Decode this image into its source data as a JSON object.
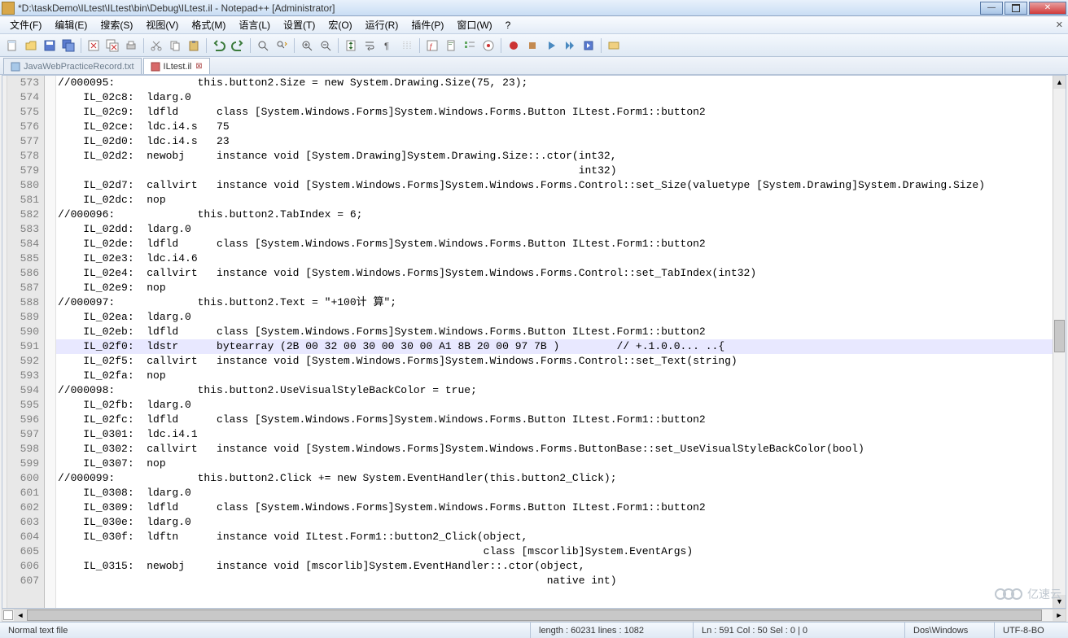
{
  "title": "*D:\\taskDemo\\ILtest\\ILtest\\bin\\Debug\\ILtest.il - Notepad++ [Administrator]",
  "menus": [
    "文件(F)",
    "编辑(E)",
    "搜索(S)",
    "视图(V)",
    "格式(M)",
    "语言(L)",
    "设置(T)",
    "宏(O)",
    "运行(R)",
    "插件(P)",
    "窗口(W)",
    "?"
  ],
  "tabs": [
    {
      "label": "JavaWebPracticeRecord.txt",
      "active": false,
      "dirty": false
    },
    {
      "label": "ILtest.il",
      "active": true,
      "dirty": true
    }
  ],
  "gutter_start": 573,
  "current_line_index": 18,
  "code_lines": [
    "//000095:             this.button2.Size = new System.Drawing.Size(75, 23);",
    "    IL_02c8:  ldarg.0",
    "    IL_02c9:  ldfld      class [System.Windows.Forms]System.Windows.Forms.Button ILtest.Form1::button2",
    "    IL_02ce:  ldc.i4.s   75",
    "    IL_02d0:  ldc.i4.s   23",
    "    IL_02d2:  newobj     instance void [System.Drawing]System.Drawing.Size::.ctor(int32,",
    "                                                                                  int32)",
    "    IL_02d7:  callvirt   instance void [System.Windows.Forms]System.Windows.Forms.Control::set_Size(valuetype [System.Drawing]System.Drawing.Size)",
    "    IL_02dc:  nop",
    "//000096:             this.button2.TabIndex = 6;",
    "    IL_02dd:  ldarg.0",
    "    IL_02de:  ldfld      class [System.Windows.Forms]System.Windows.Forms.Button ILtest.Form1::button2",
    "    IL_02e3:  ldc.i4.6",
    "    IL_02e4:  callvirt   instance void [System.Windows.Forms]System.Windows.Forms.Control::set_TabIndex(int32)",
    "    IL_02e9:  nop",
    "//000097:             this.button2.Text = \"+100计 算\";",
    "    IL_02ea:  ldarg.0",
    "    IL_02eb:  ldfld      class [System.Windows.Forms]System.Windows.Forms.Button ILtest.Form1::button2",
    "    IL_02f0:  ldstr      bytearray (2B 00 32 00 30 00 30 00 A1 8B 20 00 97 7B )         // +.1.0.0... ..{",
    "    IL_02f5:  callvirt   instance void [System.Windows.Forms]System.Windows.Forms.Control::set_Text(string)",
    "    IL_02fa:  nop",
    "//000098:             this.button2.UseVisualStyleBackColor = true;",
    "    IL_02fb:  ldarg.0",
    "    IL_02fc:  ldfld      class [System.Windows.Forms]System.Windows.Forms.Button ILtest.Form1::button2",
    "    IL_0301:  ldc.i4.1",
    "    IL_0302:  callvirt   instance void [System.Windows.Forms]System.Windows.Forms.ButtonBase::set_UseVisualStyleBackColor(bool)",
    "    IL_0307:  nop",
    "//000099:             this.button2.Click += new System.EventHandler(this.button2_Click);",
    "    IL_0308:  ldarg.0",
    "    IL_0309:  ldfld      class [System.Windows.Forms]System.Windows.Forms.Button ILtest.Form1::button2",
    "    IL_030e:  ldarg.0",
    "    IL_030f:  ldftn      instance void ILtest.Form1::button2_Click(object,",
    "                                                                   class [mscorlib]System.EventArgs)",
    "    IL_0315:  newobj     instance void [mscorlib]System.EventHandler::.ctor(object,",
    "                                                                             native int)"
  ],
  "status": {
    "filetype": "Normal text file",
    "length": "length : 60231    lines : 1082",
    "pos": "Ln : 591    Col : 50    Sel : 0 | 0",
    "eol": "Dos\\Windows",
    "encoding": "UTF-8-BO"
  },
  "brand": "亿速云",
  "win_min": "—",
  "win_close": "✕",
  "menubar_close": "✕"
}
